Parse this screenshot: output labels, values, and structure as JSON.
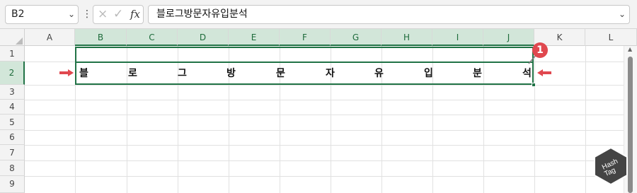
{
  "formula_bar": {
    "name_box": "B2",
    "cancel_icon": "×",
    "enter_icon": "✓",
    "fx_label": "fx",
    "formula_value": "블로그방문자유입분석"
  },
  "columns": [
    "A",
    "B",
    "C",
    "D",
    "E",
    "F",
    "G",
    "H",
    "I",
    "J",
    "K",
    "L"
  ],
  "rows": [
    "1",
    "2",
    "3",
    "4",
    "5",
    "6",
    "7",
    "8",
    "9"
  ],
  "cell_b2_chars": [
    "블",
    "로",
    "그",
    "방",
    "문",
    "자",
    "유",
    "입",
    "분",
    "석"
  ],
  "annotation": {
    "badge": "1",
    "accent_color": "#e0484f"
  },
  "colors": {
    "selection": "#217346",
    "header_selected": "#d2e6d9"
  }
}
